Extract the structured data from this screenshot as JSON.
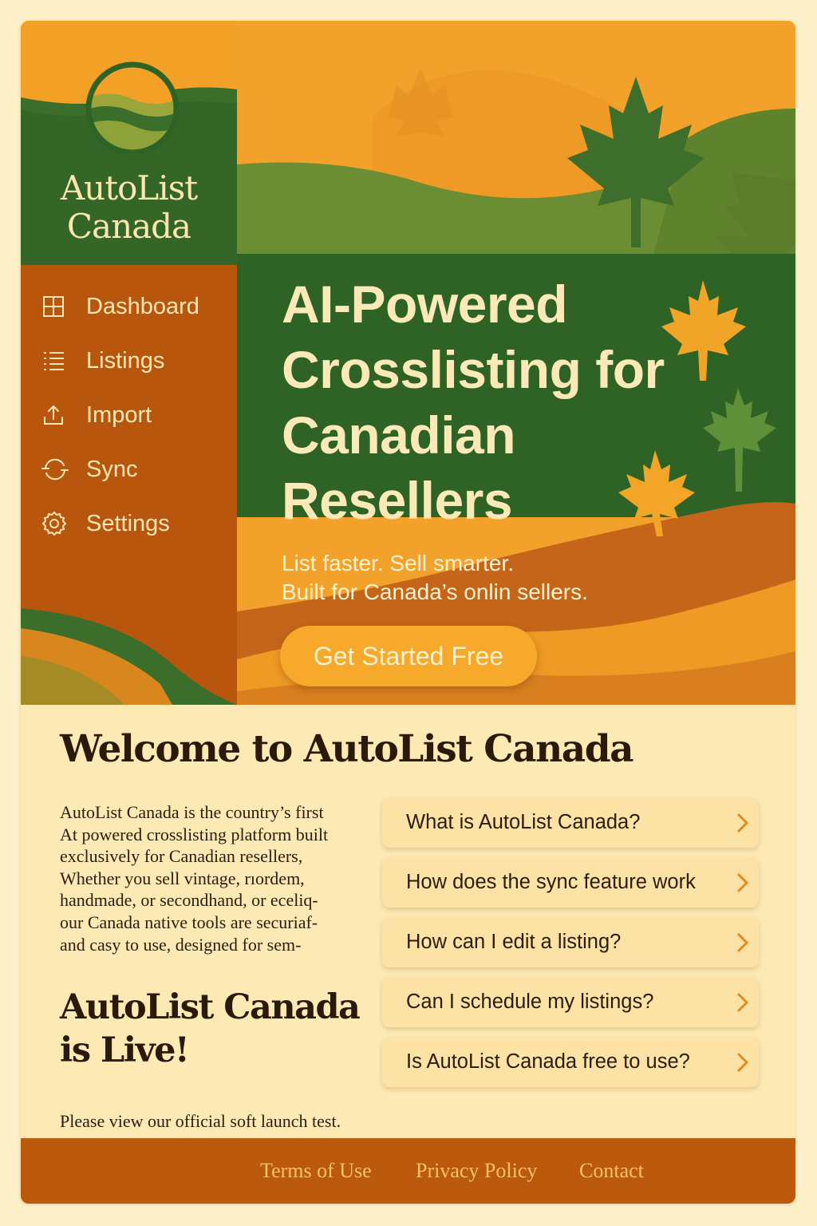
{
  "app": {
    "brand_line1": "AutoList",
    "brand_line2": "Canada"
  },
  "sidebar": {
    "items": [
      {
        "label": "Dashboard",
        "icon": "grid-icon"
      },
      {
        "label": "Listings",
        "icon": "list-icon"
      },
      {
        "label": "Import",
        "icon": "upload-icon"
      },
      {
        "label": "Sync",
        "icon": "sync-icon"
      },
      {
        "label": "Settings",
        "icon": "gear-icon"
      }
    ]
  },
  "hero": {
    "heading_line1": "AI-Powered",
    "heading_line2": "Crosslisting for",
    "heading_line3": "Canadian",
    "heading_line4": "Resellers",
    "subtitle_line1": "List faster. Sell smarter.",
    "subtitle_line2": "Built for Canada’s onlin sellers.",
    "cta_label": "Get Started Free"
  },
  "content": {
    "welcome_title": "Welcome to AutoList Canada",
    "intro_text": "AutoList Canada is the country’s first\nAt powered crosslisting platform built\nexclusively for Canadian resellers,\nWhether you sell vintage, rıordem,\nhandmade, or secondhand, or eceliq-\nour  Canada native tools are securiaf-\nand casy to use, designed for sem-",
    "live_title": "AutoList Canada\nis Live!",
    "live_note": "Please view our official soft launch test."
  },
  "faq": {
    "items": [
      {
        "question": "What is AutoList Canada?"
      },
      {
        "question": "How does the sync feature work"
      },
      {
        "question": "How can I edit a listing?"
      },
      {
        "question": "Can I schedule my listings?"
      },
      {
        "question": "Is AutoList Canada free to use?"
      }
    ]
  },
  "footer": {
    "links": [
      {
        "label": "Terms of Use"
      },
      {
        "label": "Privacy Policy"
      },
      {
        "label": "Contact"
      }
    ]
  },
  "colors": {
    "brand_green": "#2f6326",
    "brand_orange": "#f3a126",
    "sidebar_rust": "#b9560d",
    "cream": "#fde9b4",
    "footer_link": "#f7c26d"
  }
}
